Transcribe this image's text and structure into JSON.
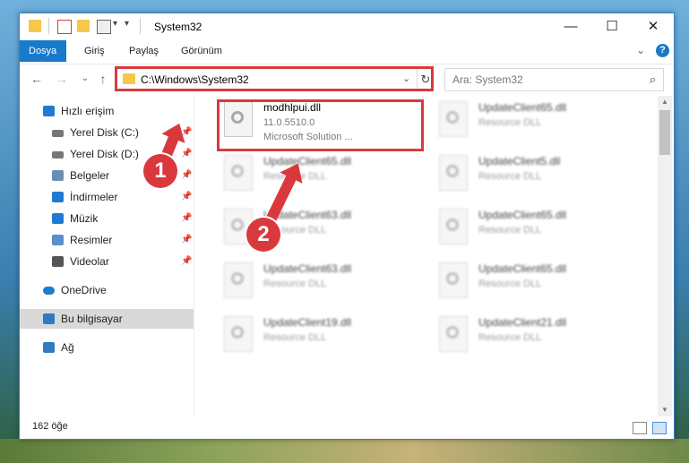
{
  "window": {
    "title": "System32",
    "controls": {
      "minimize": "—",
      "maximize": "☐",
      "close": "✕"
    }
  },
  "ribbon": {
    "tabs": [
      {
        "label": "Dosya",
        "active": true
      },
      {
        "label": "Giriş",
        "active": false
      },
      {
        "label": "Paylaş",
        "active": false
      },
      {
        "label": "Görünüm",
        "active": false
      }
    ],
    "expand_glyph": "⌄",
    "help_glyph": "?"
  },
  "navbar": {
    "back": "←",
    "forward": "→",
    "recent": "⌄",
    "up": "↑",
    "address": "C:\\Windows\\System32",
    "address_dropdown": "⌄",
    "refresh": "↻",
    "search_placeholder": "Ara: System32",
    "search_glyph": "⌕"
  },
  "sidebar": {
    "items": [
      {
        "label": "Hızlı erişim",
        "icon": "star-icon",
        "color": "#1f7ad1",
        "pinned": false
      },
      {
        "label": "Yerel Disk (C:)",
        "icon": "drive-icon",
        "color": "#555555",
        "pinned": true
      },
      {
        "label": "Yerel Disk (D:)",
        "icon": "drive-icon",
        "color": "#555555",
        "pinned": true
      },
      {
        "label": "Belgeler",
        "icon": "documents-icon",
        "color": "#6a8fb5",
        "pinned": true
      },
      {
        "label": "İndirmeler",
        "icon": "downloads-icon",
        "color": "#1f7ad1",
        "pinned": true
      },
      {
        "label": "Müzik",
        "icon": "music-icon",
        "color": "#1f7ad1",
        "pinned": true
      },
      {
        "label": "Resimler",
        "icon": "pictures-icon",
        "color": "#5b8fc9",
        "pinned": true
      },
      {
        "label": "Videolar",
        "icon": "videos-icon",
        "color": "#555555",
        "pinned": true
      },
      {
        "label": "OneDrive",
        "icon": "cloud-icon",
        "color": "#1f7ad1",
        "pinned": false
      },
      {
        "label": "Bu bilgisayar",
        "icon": "computer-icon",
        "color": "#2d7cc1",
        "pinned": false,
        "selected": true
      },
      {
        "label": "Ağ",
        "icon": "network-icon",
        "color": "#2d7cc1",
        "pinned": false
      }
    ],
    "pin_glyph": "📌"
  },
  "files": [
    {
      "name": "modhlpui.dll",
      "version": "11.0.5510.0",
      "desc": "Microsoft Solution ...",
      "blurred": false
    },
    {
      "name": "UpdateClient65.dll",
      "version": "Resource DLL",
      "desc": "",
      "blurred": true
    },
    {
      "name": "UpdateClient65.dll",
      "version": "Resource DLL",
      "desc": "",
      "blurred": true
    },
    {
      "name": "UpdateClient5.dll",
      "version": "Resource DLL",
      "desc": "",
      "blurred": true
    },
    {
      "name": "UpdateClient63.dll",
      "version": "Resource DLL",
      "desc": "",
      "blurred": true
    },
    {
      "name": "UpdateClient65.dll",
      "version": "Resource DLL",
      "desc": "",
      "blurred": true
    },
    {
      "name": "UpdateClient63.dll",
      "version": "Resource DLL",
      "desc": "",
      "blurred": true
    },
    {
      "name": "UpdateClient65.dll",
      "version": "Resource DLL",
      "desc": "",
      "blurred": true
    },
    {
      "name": "UpdateClient19.dll",
      "version": "Resource DLL",
      "desc": "",
      "blurred": true
    },
    {
      "name": "UpdateClient21.dll",
      "version": "Resource DLL",
      "desc": "",
      "blurred": true
    }
  ],
  "status": {
    "count": "162 öğe"
  },
  "annotations": [
    {
      "label": "1"
    },
    {
      "label": "2"
    }
  ],
  "colors": {
    "accent": "#1979ca",
    "highlight": "#d9393d"
  }
}
